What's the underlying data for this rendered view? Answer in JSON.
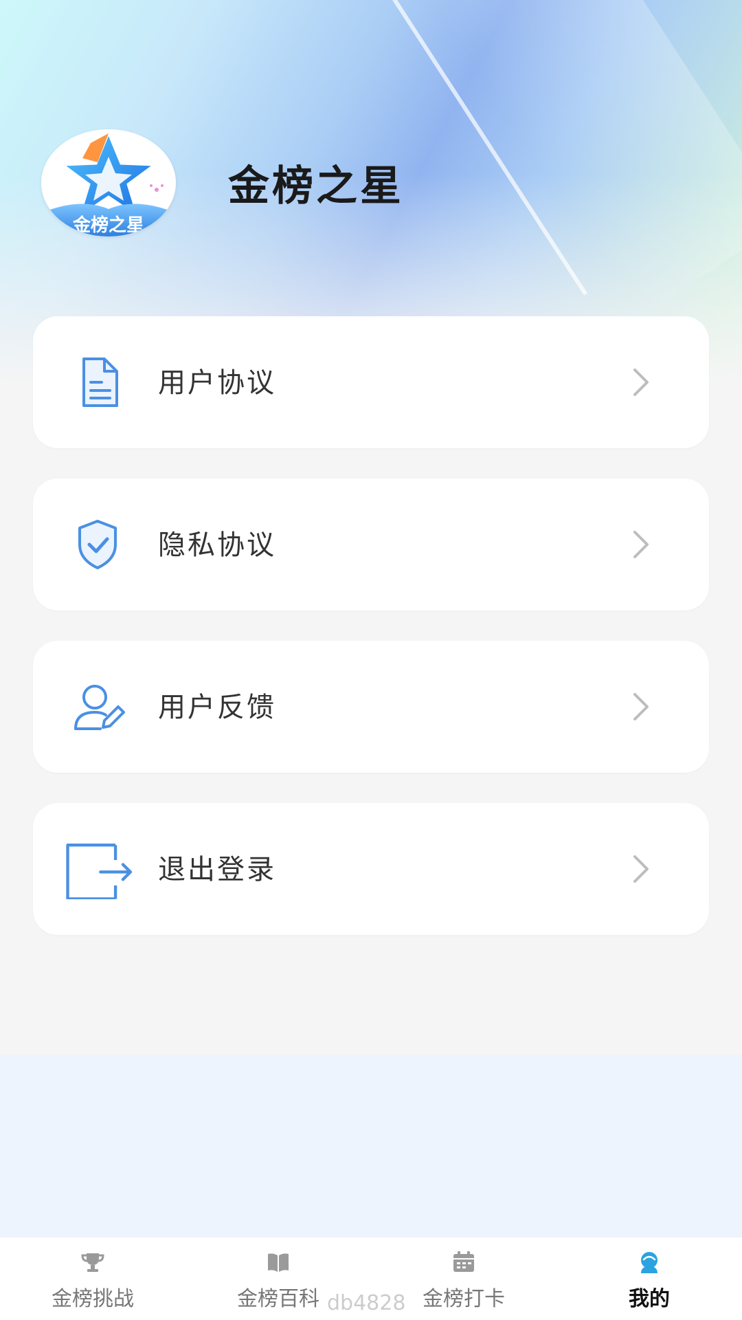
{
  "header": {
    "app_title": "金榜之星",
    "logo_text": "金榜之星"
  },
  "menu": {
    "items": [
      {
        "label": "用户协议",
        "icon": "document-icon"
      },
      {
        "label": "隐私协议",
        "icon": "shield-check-icon"
      },
      {
        "label": "用户反馈",
        "icon": "user-edit-icon"
      },
      {
        "label": "退出登录",
        "icon": "logout-icon"
      }
    ]
  },
  "tabbar": {
    "tabs": [
      {
        "label": "金榜挑战",
        "icon": "trophy-icon",
        "active": false
      },
      {
        "label": "金榜百科",
        "icon": "book-icon",
        "active": false
      },
      {
        "label": "金榜打卡",
        "icon": "calendar-icon",
        "active": false
      },
      {
        "label": "我的",
        "icon": "profile-icon",
        "active": true
      }
    ]
  },
  "watermark": "db4828",
  "colors": {
    "accent": "#4a90e2",
    "tab_active_icon": "#2aa3e0",
    "tab_inactive_icon": "#9a9a9a"
  }
}
